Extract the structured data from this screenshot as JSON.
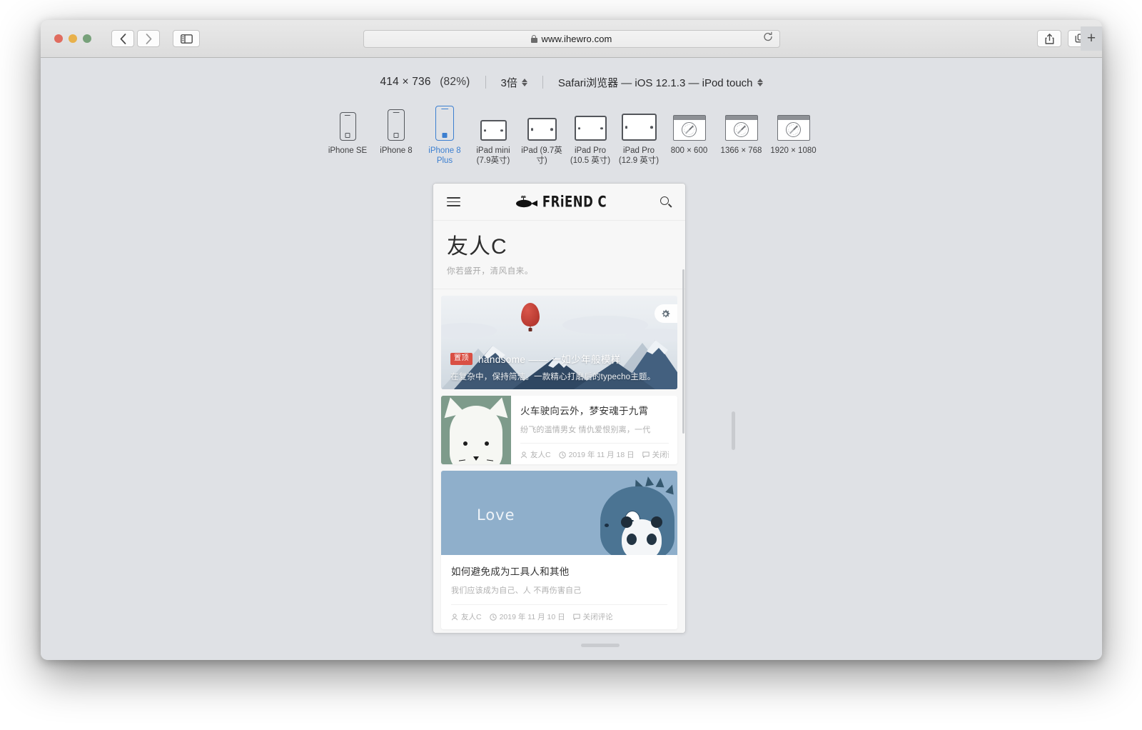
{
  "browser": {
    "window_controls": [
      "close",
      "minimize",
      "zoom"
    ],
    "back_label": "‹",
    "forward_label": "›",
    "sidebar_label": "sidebar",
    "address": "www.ihewro.com",
    "reload_label": "↻",
    "share_label": "share",
    "tabs_label": "tabs",
    "new_tab_label": "+"
  },
  "responsive_toolbar": {
    "dimensions": "414 × 736",
    "zoom_percent": "(82%)",
    "scale": "3倍",
    "user_agent": "Safari浏览器 — iOS 12.1.3 — iPod touch"
  },
  "devices": [
    {
      "name": "iPhone SE",
      "label": "iPhone SE",
      "type": "phone",
      "selected": false
    },
    {
      "name": "iPhone 8",
      "label": "iPhone 8",
      "type": "phone",
      "selected": false
    },
    {
      "name": "iPhone 8 Plus",
      "label": "iPhone 8 Plus",
      "type": "phone",
      "selected": true
    },
    {
      "name": "iPad mini",
      "label": "iPad mini (7.9英寸)",
      "type": "tablet",
      "selected": false
    },
    {
      "name": "iPad",
      "label": "iPad (9.7英寸)",
      "type": "tablet",
      "selected": false
    },
    {
      "name": "iPad Pro 10.5",
      "label": "iPad Pro (10.5 英寸)",
      "type": "tablet",
      "selected": false
    },
    {
      "name": "iPad Pro 12.9",
      "label": "iPad Pro (12.9 英寸)",
      "type": "tablet",
      "selected": false
    },
    {
      "name": "800 × 600",
      "label": "800 × 600",
      "type": "browser",
      "selected": false
    },
    {
      "name": "1366 × 768",
      "label": "1366 × 768",
      "type": "browser",
      "selected": false
    },
    {
      "name": "1920 × 1080",
      "label": "1920 × 1080",
      "type": "browser",
      "selected": false
    }
  ],
  "site": {
    "logo_text": "FRiEND C",
    "menu_icon": "hamburger-icon",
    "search_icon": "search-icon",
    "title": "友人C",
    "description": "你若盛开，清风自来。"
  },
  "hero": {
    "badge": "置顶",
    "title": "handsome —— 一如少年般模样",
    "subtitle": "在复杂中，保持简洁。一款精心打磨后的typecho主题。",
    "gear_icon": "gear-icon"
  },
  "posts": [
    {
      "layout": "horizontal",
      "thumbnail": "cat-illustration",
      "title": "火车驶向云外，梦安魂于九霄",
      "excerpt": "纷飞的滥情男女 情仇爱恨别离，一代",
      "author": "友人C",
      "date": "2019 年 11 月 18 日",
      "comments": "关闭评论"
    },
    {
      "layout": "vertical",
      "cover": "godzilla-panda-illustration",
      "cover_text": "Love",
      "title": "如何避免成为工具人和其他",
      "excerpt": "我们应该成为自己、人 不再伤害自己",
      "author": "友人C",
      "date": "2019 年 11 月 10 日",
      "comments": "关闭评论"
    }
  ],
  "colors": {
    "accent_blue": "#3c7fd0",
    "badge_red": "#d94f43",
    "toolbar_bg": "#dfe1e5",
    "cat_card_bg": "#7e9b8b",
    "dino_card_bg": "#8fafcb"
  }
}
